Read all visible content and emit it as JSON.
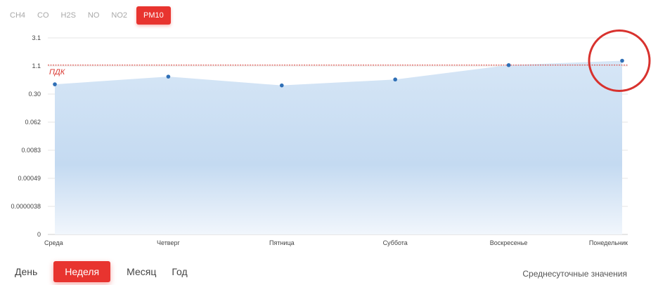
{
  "pollutant_tabs": [
    {
      "label": "CH4"
    },
    {
      "label": "CO"
    },
    {
      "label": "H2S"
    },
    {
      "label": "NO"
    },
    {
      "label": "NO2"
    },
    {
      "label": "PM10",
      "active": true
    }
  ],
  "period_tabs": [
    {
      "label": "День"
    },
    {
      "label": "Неделя",
      "active": true
    },
    {
      "label": "Месяц"
    },
    {
      "label": "Год"
    }
  ],
  "footer_note": "Среднесуточные значения",
  "colors": {
    "accent": "#e8342f",
    "area_fill": "#c5dcf2",
    "point": "#2f6fb6",
    "threshold": "#d9362f",
    "highlight_circle": "#d8322e"
  },
  "chart_data": {
    "type": "area",
    "categories": [
      "Среда",
      "Четверг",
      "Пятница",
      "Суббота",
      "Воскресенье",
      "Понедельник"
    ],
    "series": [
      {
        "values": [
          0.45,
          0.62,
          0.43,
          0.55,
          1.0,
          1.2
        ]
      }
    ],
    "y_scale": "log",
    "y_ticks": [
      "3.1",
      "1.1",
      "0.30",
      "0.062",
      "0.0083",
      "0.00049",
      "0.0000038",
      "0"
    ],
    "threshold": {
      "label": "ПДК",
      "value": 1.0
    },
    "grid": true,
    "annotation": {
      "type": "circle",
      "category": "Понедельник"
    }
  }
}
